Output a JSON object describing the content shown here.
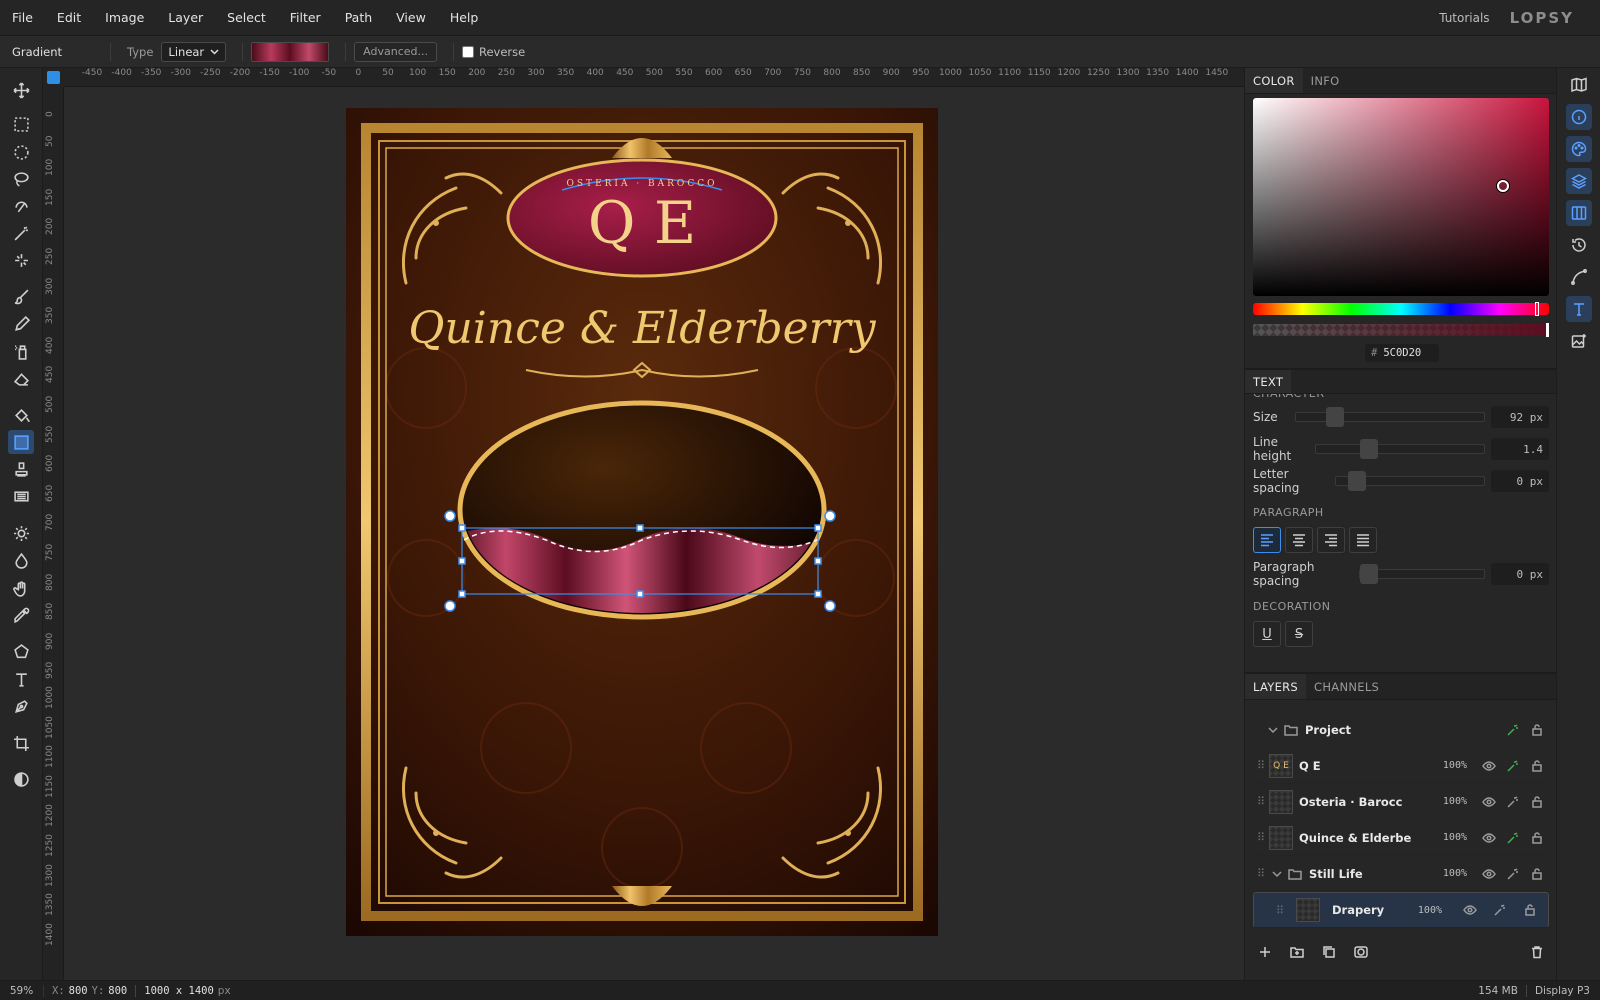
{
  "menu": [
    "File",
    "Edit",
    "Image",
    "Layer",
    "Select",
    "Filter",
    "Path",
    "View",
    "Help"
  ],
  "menu_right": {
    "tutorials": "Tutorials",
    "logo": "LOPSY"
  },
  "options": {
    "tool_name": "Gradient",
    "type_label": "Type",
    "type_value": "Linear",
    "advanced_label": "Advanced...",
    "reverse_label": "Reverse"
  },
  "ruler": {
    "h_ticks": [
      "-450",
      "-400",
      "-350",
      "-300",
      "-250",
      "-200",
      "-150",
      "-100",
      "-50",
      "0",
      "50",
      "100",
      "150",
      "200",
      "250",
      "300",
      "350",
      "400",
      "450",
      "500",
      "550",
      "600",
      "650",
      "700",
      "750",
      "800",
      "850",
      "900",
      "950",
      "1000",
      "1050",
      "1100",
      "1150",
      "1200",
      "1250",
      "1300",
      "1350",
      "1400",
      "1450"
    ],
    "v_ticks": [
      "0",
      "50",
      "100",
      "150",
      "200",
      "250",
      "300",
      "350",
      "400",
      "450",
      "500",
      "550",
      "600",
      "650",
      "700",
      "750",
      "800",
      "850",
      "900",
      "950",
      "1000",
      "1050",
      "1100",
      "1150",
      "1200",
      "1250",
      "1300",
      "1350",
      "1400"
    ]
  },
  "document": {
    "monogram": "Q E",
    "arc_text": "OSTERIA · BAROCCO",
    "title": "Quince & Elderberry"
  },
  "color_panel": {
    "tabs": [
      "COLOR",
      "INFO"
    ],
    "hex_symbol": "#",
    "hex_value": "5C0D20",
    "accent": "#5C0D20"
  },
  "text_panel": {
    "tab": "TEXT",
    "char_heading": "CHARACTER",
    "size_label": "Size",
    "size_value": "92 px",
    "line_height_label": "Line height",
    "line_height_value": "1.4",
    "letter_spacing_label": "Letter spacing",
    "letter_spacing_value": "0 px",
    "paragraph_heading": "PARAGRAPH",
    "paragraph_spacing_label": "Paragraph spacing",
    "paragraph_spacing_value": "0 px",
    "decoration_heading": "DECORATION",
    "underline": "U",
    "strike": "S"
  },
  "layers_panel": {
    "tabs": [
      "LAYERS",
      "CHANNELS"
    ],
    "layers": [
      {
        "name": "Project",
        "opacity": ""
      },
      {
        "name": "Q E",
        "opacity": "100%",
        "thumb": "Q E"
      },
      {
        "name": "Osteria · Barocc",
        "opacity": "100%"
      },
      {
        "name": "Quince & Elderbe",
        "opacity": "100%"
      },
      {
        "name": "Still Life",
        "opacity": "100%"
      },
      {
        "name": "Drapery",
        "opacity": "100%"
      }
    ]
  },
  "status": {
    "zoom": "59%",
    "x_label": "X:",
    "x_value": "800",
    "y_label": "Y:",
    "y_value": "800",
    "doc_size": "1000 x 1400",
    "doc_unit": "px",
    "memory": "154 MB",
    "profile": "Display P3"
  }
}
